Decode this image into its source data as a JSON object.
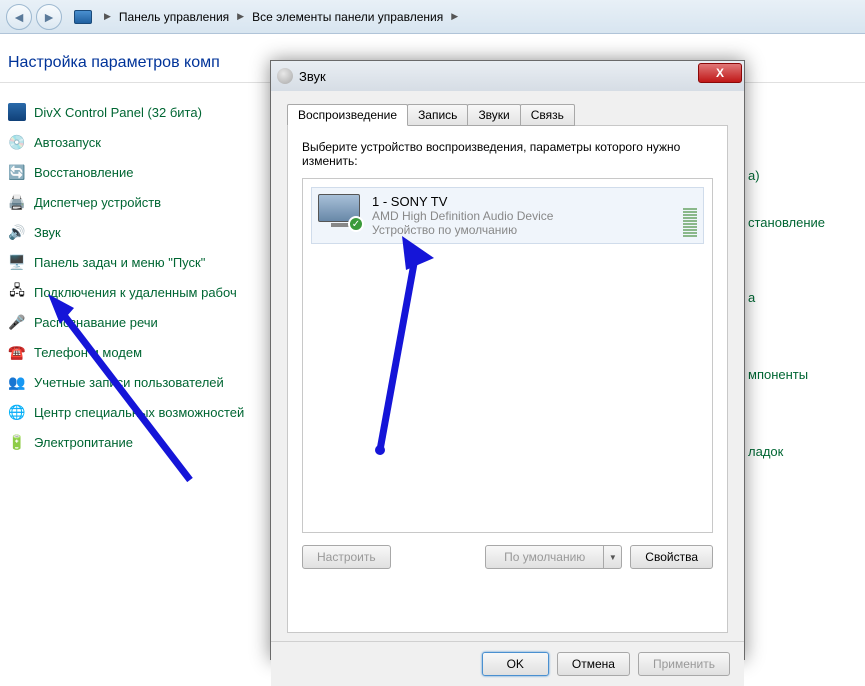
{
  "topbar": {
    "breadcrumb": [
      "Панель управления",
      "Все элементы панели управления"
    ]
  },
  "page": {
    "title": "Настройка параметров комп"
  },
  "cpl_items": [
    {
      "label": "DivX Control Panel (32 бита)"
    },
    {
      "label": "Автозапуск"
    },
    {
      "label": "Восстановление"
    },
    {
      "label": "Диспетчер устройств"
    },
    {
      "label": "Звук"
    },
    {
      "label": "Панель задач и меню \"Пуск\""
    },
    {
      "label": "Подключения к удаленным рабоч"
    },
    {
      "label": "Распознавание речи"
    },
    {
      "label": "Телефон и модем"
    },
    {
      "label": "Учетные записи пользователей"
    },
    {
      "label": "Центр специальных возможностей"
    },
    {
      "label": "Электропитание"
    }
  ],
  "right_items": [
    "а)",
    "становление",
    "а",
    "мпоненты",
    "ладок"
  ],
  "dialog": {
    "title": "Звук",
    "tabs": [
      "Воспроизведение",
      "Запись",
      "Звуки",
      "Связь"
    ],
    "active_tab": 0,
    "instruction": "Выберите устройство воспроизведения, параметры которого нужно изменить:",
    "device": {
      "name": "1 - SONY TV",
      "driver": "AMD High Definition Audio Device",
      "status": "Устройство по умолчанию"
    },
    "buttons": {
      "configure": "Настроить",
      "default": "По умолчанию",
      "properties": "Свойства",
      "ok": "OK",
      "cancel": "Отмена",
      "apply": "Применить"
    }
  },
  "colors": {
    "link": "#006633",
    "title": "#003399",
    "arrow": "#1515d8"
  }
}
